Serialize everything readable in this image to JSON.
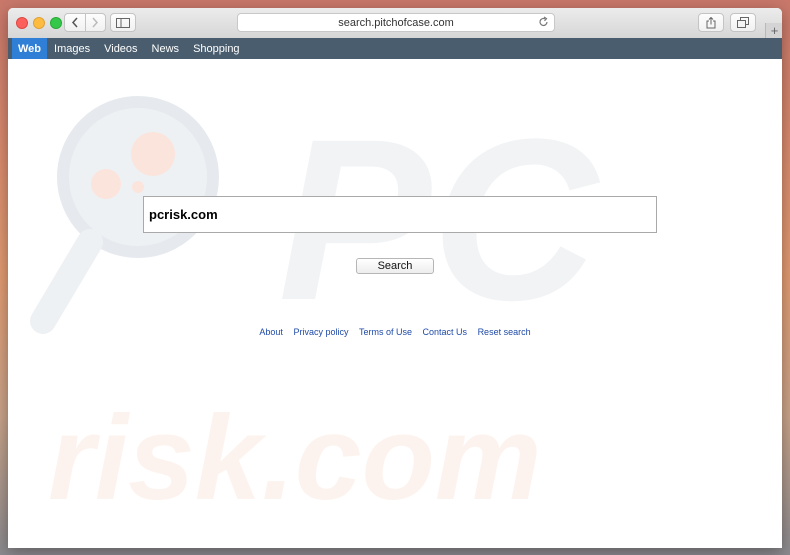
{
  "browser": {
    "url": "search.pitchofcase.com",
    "icons": {
      "back": "chevron-left-icon",
      "forward": "chevron-right-icon",
      "sidebar": "sidebar-icon",
      "reload": "reload-icon",
      "share": "share-icon",
      "tabs": "tabs-icon",
      "new_tab": "plus-icon"
    },
    "new_tab_glyph": "+"
  },
  "navbar": {
    "items": [
      {
        "label": "Web",
        "active": true
      },
      {
        "label": "Images",
        "active": false
      },
      {
        "label": "Videos",
        "active": false
      },
      {
        "label": "News",
        "active": false
      },
      {
        "label": "Shopping",
        "active": false
      }
    ],
    "background": "#4a5d6e",
    "active_color": "#2f7fd6"
  },
  "search": {
    "query": "pcrisk.com",
    "button_label": "Search"
  },
  "footer": {
    "links": [
      "About",
      "Privacy policy",
      "Terms of Use",
      "Contact Us",
      "Reset search"
    ],
    "link_color": "#1f4aa8"
  },
  "watermark": {
    "text_top": "PC",
    "text_bottom": "risk.com"
  }
}
